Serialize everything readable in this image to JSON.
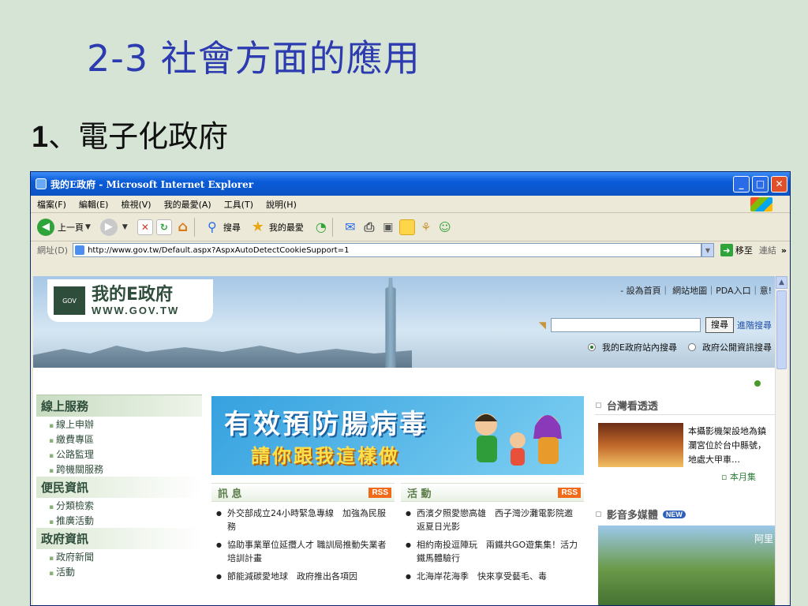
{
  "slide": {
    "title": "2-3 社會方面的應用",
    "subtitle_num": "1",
    "subtitle_text": "、電子化政府"
  },
  "window": {
    "title": "我的E政府 - Microsoft Internet Explorer",
    "controls": {
      "minimize": "_",
      "maximize": "□",
      "close": "✕"
    }
  },
  "menu": [
    "檔案(F)",
    "編輯(E)",
    "檢視(V)",
    "我的最愛(A)",
    "工具(T)",
    "說明(H)"
  ],
  "toolbar": {
    "back": "上一頁",
    "search": "搜尋",
    "favorites": "我的最愛"
  },
  "address": {
    "label": "網址(D)",
    "url": "http://www.gov.tw/Default.aspx?AspxAutoDetectCookieSupport=1",
    "go": "移至",
    "links": "連結",
    "more": "»"
  },
  "site": {
    "logo_main": "我的E政府",
    "logo_sub": "WWW.GOV.TW",
    "logo_mark": "GOV",
    "top_links": "- 設為首頁｜ 網站地圖｜PDA入口｜意!",
    "search_button": "搜尋",
    "advanced_search": "進階搜尋",
    "radio1": "我的E政府站內搜尋",
    "radio2": "政府公開資訊搜尋",
    "sidebar": [
      {
        "heading": "線上服務",
        "items": [
          "線上申辦",
          "繳費專區",
          "公路監理",
          "跨機關服務"
        ]
      },
      {
        "heading": "便民資訊",
        "items": [
          "分類檢索",
          "推廣活動"
        ]
      },
      {
        "heading": "政府資訊",
        "items": [
          "政府新聞",
          "活動"
        ]
      }
    ],
    "banner_line1": "有效預防腸病毒",
    "banner_line2": "請你跟我這樣做",
    "news": {
      "heading": "訊 息",
      "rss": "RSS",
      "items": [
        "外交部成立24小時緊急專線　加強為民服務",
        "協助事業單位延攬人才 職訓局推動失業者培訓計畫",
        "節能減碳愛地球　政府推出各項因"
      ]
    },
    "activities": {
      "heading": "活 動",
      "rss": "RSS",
      "items": [
        "西濱夕照愛戀高雄　西子灣沙灘電影院邀返夏日光影",
        "相約南投逗陣玩　兩鐵共GO遊集集！活力鐵馬體驗行",
        "北海岸花海季　快來享受藝毛、毒"
      ]
    },
    "taiwan": {
      "heading": "台灣看透透",
      "text": "本攝影機架設地為鎮瀾宮位於台中縣號，地處大甲車…",
      "more": "▫ 本月集"
    },
    "multimedia": {
      "heading": "影音多媒體",
      "badge": "NEW",
      "caption": "阿里"
    }
  }
}
